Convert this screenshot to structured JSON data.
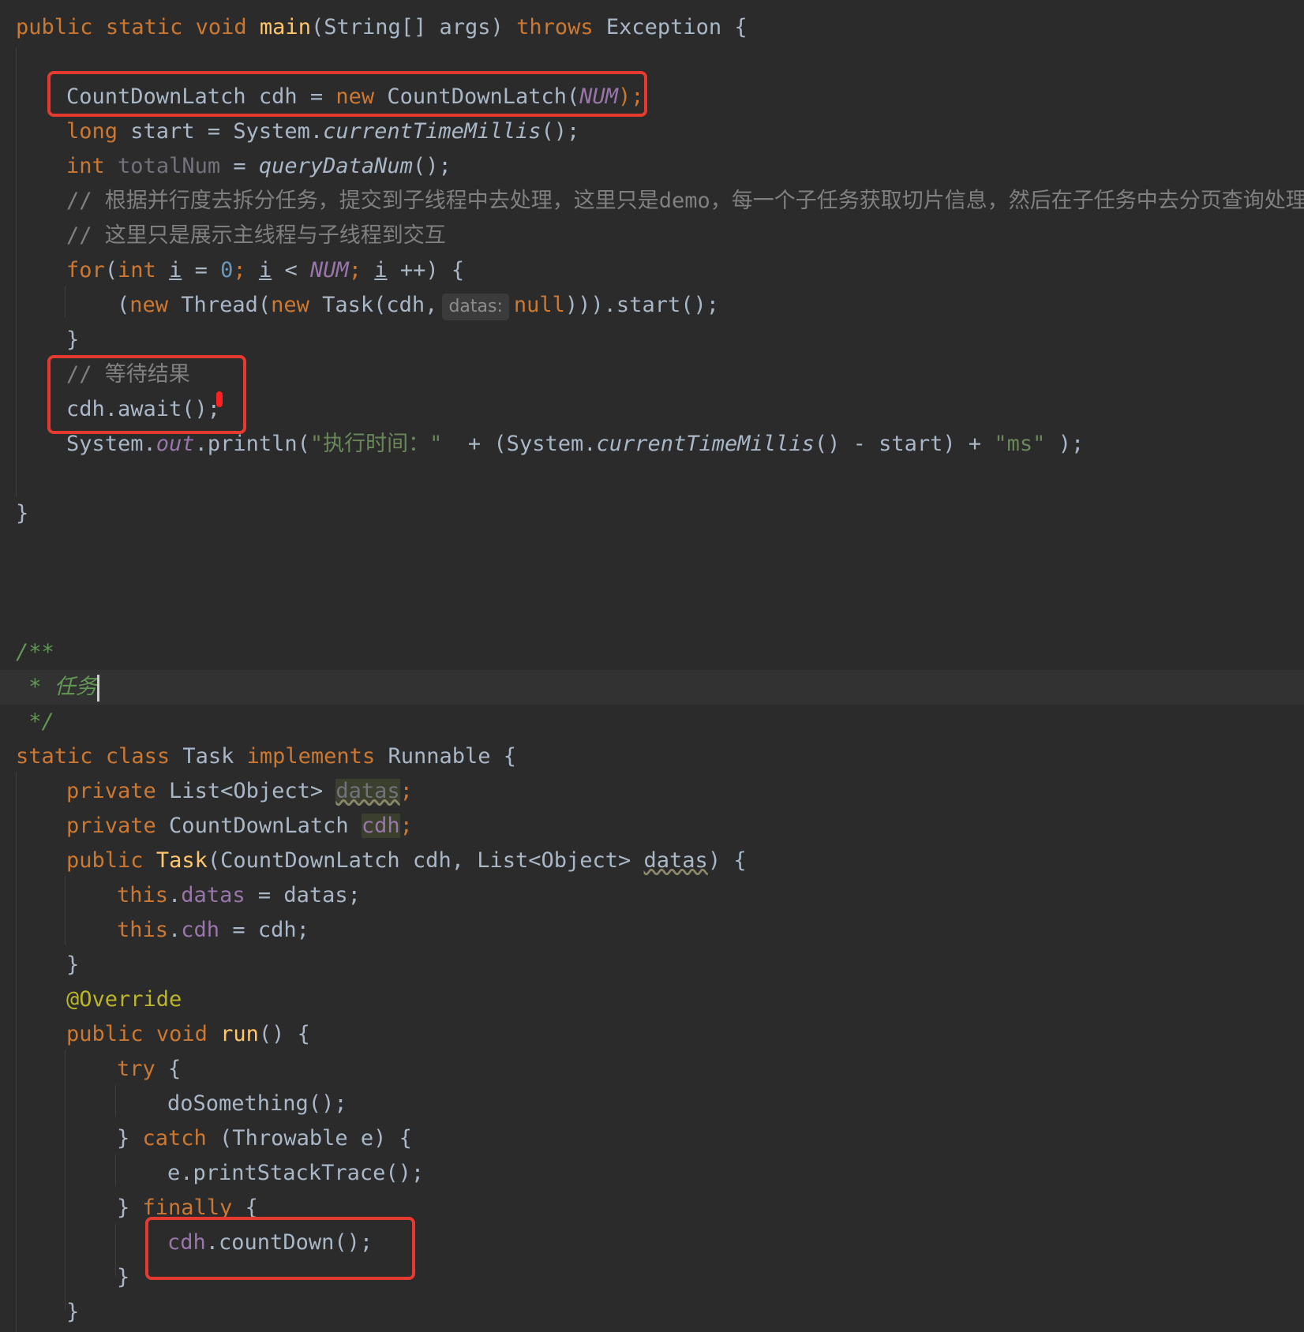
{
  "editor": {
    "main_method": {
      "signature": {
        "public": "public",
        "static": "static",
        "void": "void",
        "name": "main",
        "params": "(String[] args)",
        "throws": "throws",
        "exception": "Exception {"
      },
      "latch_decl": {
        "type_var": "CountDownLatch cdh = ",
        "new": "new",
        "ctor": " CountDownLatch(",
        "const": "NUM",
        "close": ");"
      },
      "start_line": {
        "type": "long",
        "rest": " start = System.",
        "method": "currentTimeMillis",
        "close": "();"
      },
      "total_line": {
        "type": "int",
        "var": "totalNum",
        "eq": " = ",
        "method": "queryDataNum",
        "close": "();"
      },
      "comment1": "// 根据并行度去拆分任务，提交到子线程中去处理，这里只是demo，每一个子任务获取切片信息，然后在子任务中去分页查询处理",
      "comment2": "// 这里只是展示主线程与子线程到交互",
      "for_line": {
        "for": "for",
        "int": "int",
        "i": "i",
        "zero": "0",
        "const": "NUM"
      },
      "thread_line": {
        "new": "new",
        "thread": " Thread(",
        "task": " Task(cdh,",
        "hint": "datas:",
        "null": "null",
        "end": "))).start();"
      },
      "close_brace": "}",
      "wait_comment": "// 等待结果",
      "await_line": "cdh.await();",
      "println_line": {
        "sys": "System.",
        "out": "out",
        "println": ".println(",
        "str1": "\"执行时间：\"",
        "mid": "  + (System.",
        "method": "currentTimeMillis",
        "rest": "() - start) + ",
        "str2": "\"ms\"",
        "end": " );"
      },
      "method_close": "}"
    },
    "task_class": {
      "doc_open": "/**",
      "doc_body": " * 任务",
      "doc_close": " */",
      "decl": {
        "static": "static",
        "class": "class",
        "name": " Task ",
        "implements": "implements",
        "iface": " Runnable {"
      },
      "field1": {
        "private": "private",
        "type": " List<Object> ",
        "name": "datas"
      },
      "field2": {
        "private": "private",
        "type": " CountDownLatch ",
        "name": "cdh"
      },
      "ctor": {
        "public": "public",
        "name": "Task",
        "params1": "(CountDownLatch cdh, List<Object> ",
        "param2": "datas",
        "close": ") {"
      },
      "assign1": {
        "this": "this",
        "field": "datas",
        "rest": " = datas;"
      },
      "assign2": {
        "this": "this",
        "field": "cdh",
        "rest": " = cdh;"
      },
      "override": "@Override",
      "run": {
        "public": "public",
        "void": "void",
        "name": "run",
        "rest": "() {"
      },
      "try": "try",
      "do_something": "doSomething();",
      "catch_line": {
        "brace": "} ",
        "catch": "catch",
        "rest": " (Throwable e) {"
      },
      "print_stack": "e.printStackTrace();",
      "finally_line": {
        "brace": "} ",
        "finally": "finally",
        "rest": " {"
      },
      "count_down": {
        "field": "cdh",
        "rest": ".countDown();"
      },
      "brace": "}"
    }
  },
  "colors": {
    "background": "#2b2b2b",
    "keyword": "#cc7832",
    "highlight_box": "#e53a2f",
    "comment": "#808080",
    "string": "#6a8759",
    "field": "#9876aa"
  }
}
